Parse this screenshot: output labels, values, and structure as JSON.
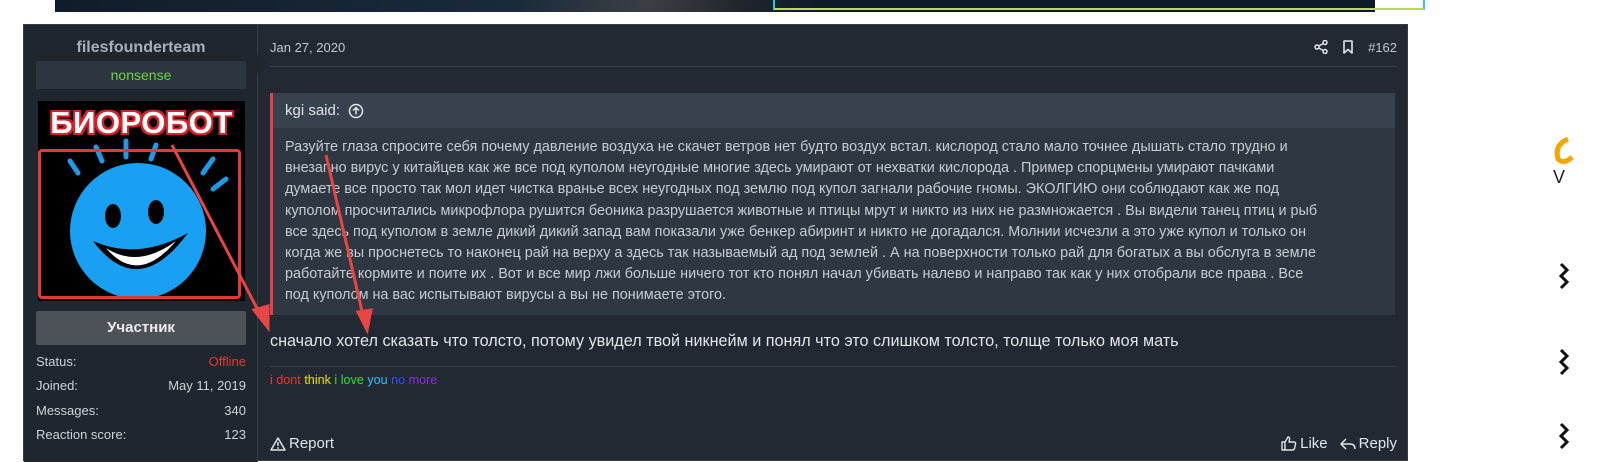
{
  "colors": {
    "page_bg": "#ffffff",
    "post_bg": "#222933",
    "user_col_bg": "#20262e",
    "usertitle_color": "#6dd63a",
    "offline_color": "#e53935",
    "quote_accent": "#e0424a",
    "arrow_color": "#e84545"
  },
  "user": {
    "name": "filesfounderteam",
    "title": "nonsense",
    "avatar_caption": "БИОРОБОТ",
    "badge": "Участник",
    "stats": [
      {
        "label": "Status:",
        "value": "Offline"
      },
      {
        "label": "Joined:",
        "value": "May 11, 2019"
      },
      {
        "label": "Messages:",
        "value": "340"
      },
      {
        "label": "Reaction score:",
        "value": "123"
      }
    ]
  },
  "post": {
    "date": "Jan 27, 2020",
    "number": "#162",
    "share_icon": "share-icon",
    "bookmark_icon": "bookmark-icon",
    "quote": {
      "author_line": "kgi said:",
      "jump_icon": "arrow-up-circle-icon",
      "lines": [
        "Разуйте глаза спросите себя почему давление воздуха не скачет ветров нет будто воздух встал. кислород стало мало точнее дышать стало трудно и",
        "внезапно вирус у китайцев как же все под куполом неугодные многие здесь умирают от нехватки кислорода . Пример спорцмены умирают пачками",
        "думаете все просто так мол идет чистка вранье всех неугодных под землю под купол загнали рабочие гномы. ЭКОЛГИЮ они соблюдают как же под",
        "куполом просчитались микрофлора рушится беоника разрушается животные и птицы мрут и никто из них не размножается . Вы видели танец птиц и рыб",
        "все здесь под куполом в земле дикий дикий запад вам показали уже бенкер абиринт и никто не догадался. Молнии исчезли а это уже купол и только он",
        "когда же вы проснетесь то наконец рай на верху а здесь так называемый ад под землей . А на поверхности только рай для богатых а вы обслуга в земле",
        "работайте кормите и поите их . Вот и все мир лжи больше ничего тот кто понял начал убивать налево и направо так как у них отобрали все права . Все",
        "под куполом на вас испытывают вирусы а вы не понимаете этого."
      ]
    },
    "message": "сначало хотел сказать что толсто, потому увидел твой никнейм и понял что это слишком толсто, толще только моя мать",
    "signature": [
      "i dont",
      "think",
      "i love",
      "you",
      "no",
      "more"
    ],
    "actions": {
      "report": "Report",
      "like": "Like",
      "reply": "Reply"
    }
  }
}
